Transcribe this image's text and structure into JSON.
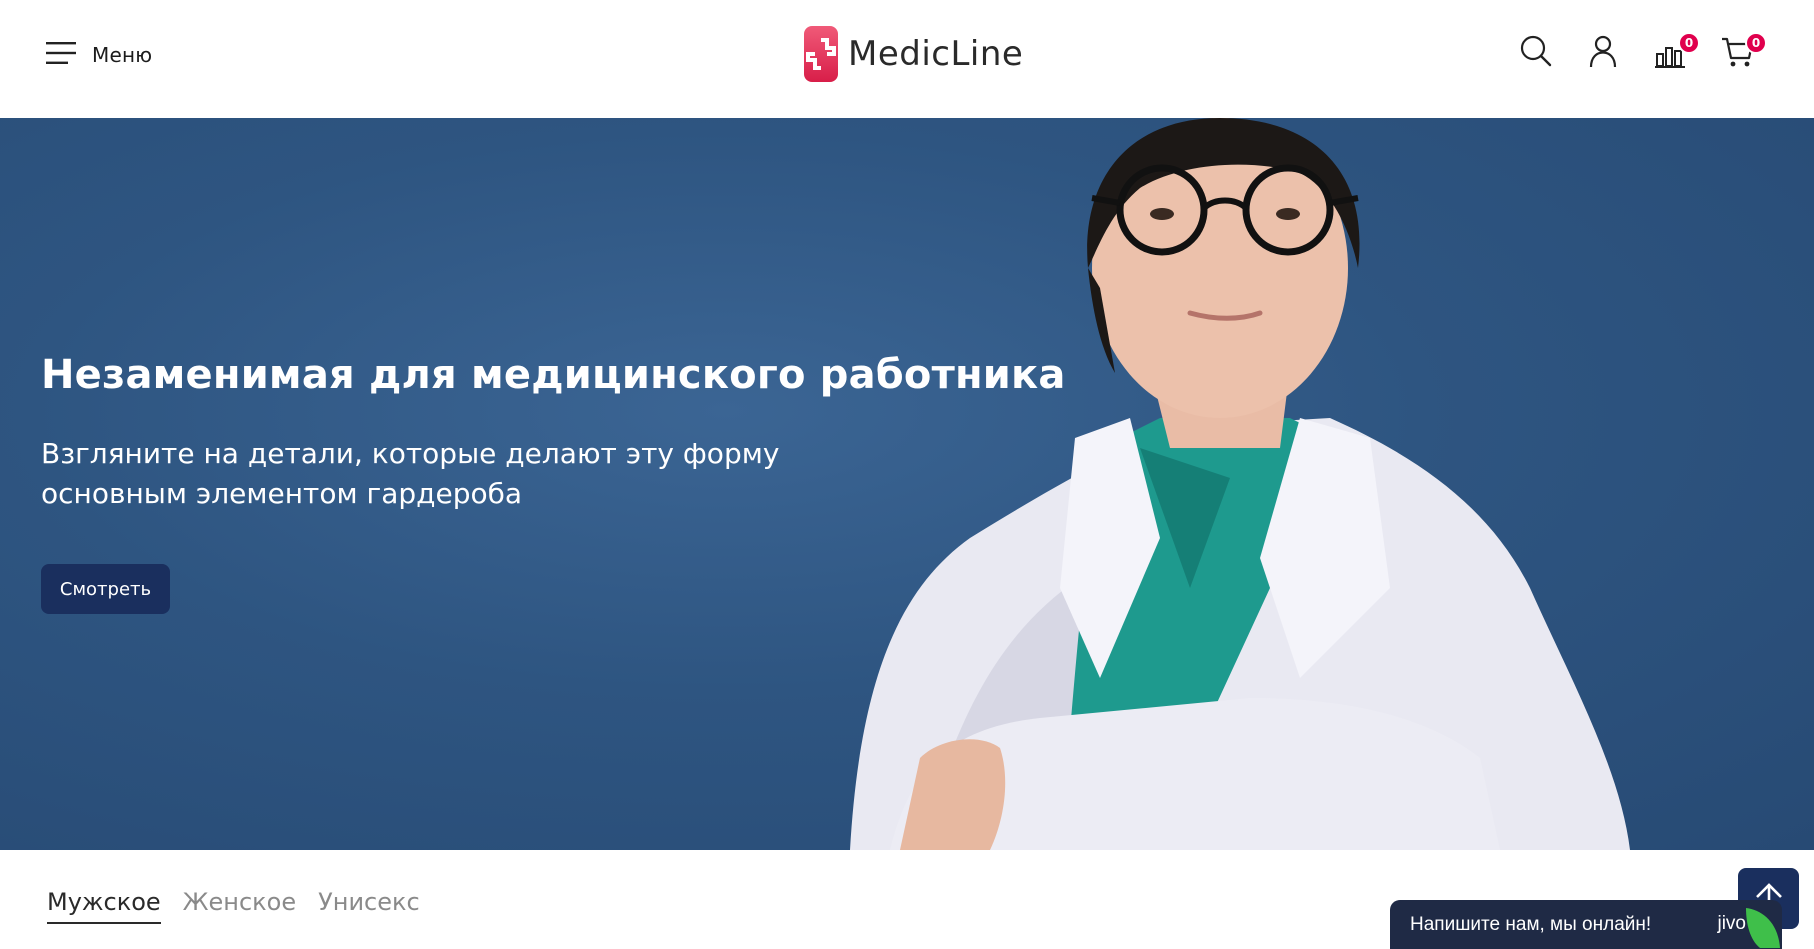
{
  "header": {
    "menu_label": "Меню",
    "brand": "MedicLine",
    "compare_count": "0",
    "cart_count": "0",
    "icons": [
      "menu-icon",
      "search-icon",
      "user-icon",
      "compare-icon",
      "cart-icon"
    ]
  },
  "hero": {
    "title": "Незаменимая для медицинского работника",
    "subtitle_line1": "Взгляните на детали, которые делают эту форму",
    "subtitle_line2": "основным элементом гардероба",
    "button_label": "Смотреть"
  },
  "tabs": [
    {
      "label": "Мужское",
      "active": true
    },
    {
      "label": "Женское",
      "active": false
    },
    {
      "label": "Унисекс",
      "active": false
    }
  ],
  "chat": {
    "text": "Напишите нам, мы онлайн!",
    "brand": "jivo"
  },
  "colors": {
    "accent_dark_blue": "#1a2f5e",
    "hero_bg": "#2e5581",
    "badge": "#e0004d",
    "logo_pink": "#e8365a"
  }
}
